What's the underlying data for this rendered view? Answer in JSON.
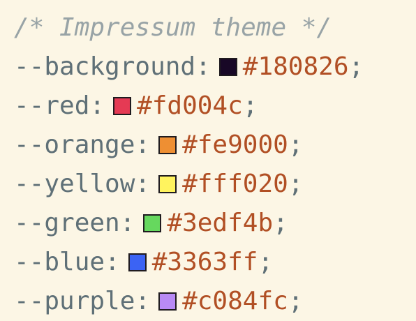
{
  "theme": {
    "comment": "/* Impressum theme */",
    "variables": [
      {
        "name": "--background",
        "hex": "#180826"
      },
      {
        "name": "--red",
        "hex": "#fd004c"
      },
      {
        "name": "--orange",
        "hex": "#fe9000"
      },
      {
        "name": "--yellow",
        "hex": "#fff020"
      },
      {
        "name": "--green",
        "hex": "#3edf4b"
      },
      {
        "name": "--blue",
        "hex": "#3363ff"
      },
      {
        "name": "--purple",
        "hex": "#c084fc"
      }
    ]
  },
  "colors": {
    "background": "#fcf6e5",
    "comment": "#98a3a6",
    "property": "#5f7077",
    "value": "#b14f24",
    "swatch_border": "#1f1b1f",
    "swatch_background": "#180826",
    "swatch_red": "#e53a54",
    "swatch_orange": "#ee8f33",
    "swatch_yellow": "#fff35e",
    "swatch_green": "#66d85e",
    "swatch_blue": "#3b63f4",
    "swatch_purple": "#b88af5"
  }
}
